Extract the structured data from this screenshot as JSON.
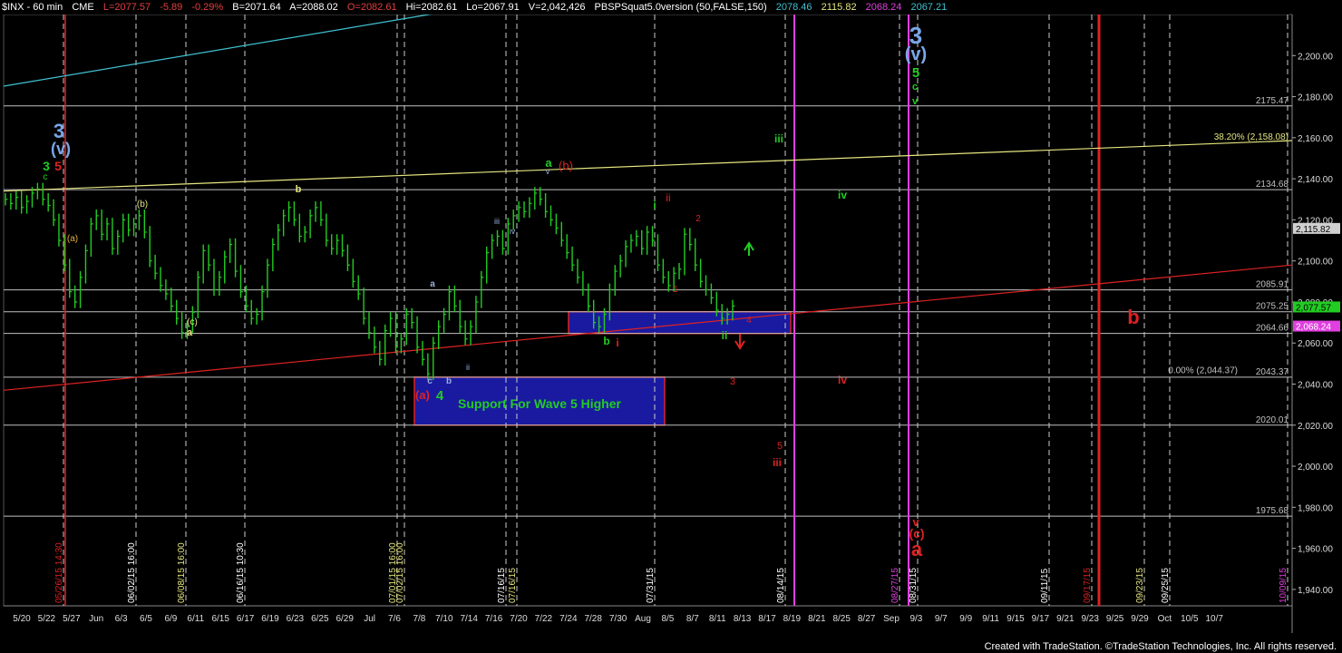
{
  "header": {
    "symbol": "$INX - 60 min",
    "exchange": "CME",
    "last": "L=2077.57",
    "change": "-5.89",
    "change_pct": "-0.29%",
    "bid": "B=2071.64",
    "ask": "A=2088.02",
    "open": "O=2082.61",
    "high": "Hi=2082.61",
    "low": "Lo=2067.91",
    "volume": "V=2,042,426",
    "indicator": "PBSPSquat5.0version (50,FALSE,150)",
    "ind_v1": "2078.46",
    "ind_v2": "2115.82",
    "ind_v3": "2068.24",
    "ind_v4": "2067.21"
  },
  "footer": "Created with TradeStation. ©TradeStation Technologies, Inc. All rights reserved.",
  "colors": {
    "background": "#000000",
    "price_bars": "#22cc22",
    "support_box": "#1a1aa0",
    "red_line": "#dd2222",
    "yellow_line": "#e6e680",
    "cyan_line": "#40c0d0",
    "magenta_line": "#e040e0",
    "grid_dash": "#ffffff"
  },
  "chart_data": {
    "type": "line",
    "title": "",
    "xlabel": "",
    "ylabel": "",
    "ylim": [
      1932,
      2220
    ],
    "y_ticks": [
      1940,
      1960,
      1980,
      2000,
      2020,
      2040,
      2060,
      2080,
      2100,
      2120,
      2140,
      2160,
      2180,
      2200
    ],
    "y_tick_labels": [
      "1,940.00",
      "1,960.00",
      "1,980.00",
      "2,000.00",
      "2,020.00",
      "2,040.00",
      "2,060.00",
      "2,080.00",
      "2,100.00",
      "2,120.00",
      "2,140.00",
      "2,160.00",
      "2,180.00",
      "2,200.00"
    ],
    "x_ticks": [
      "5/20",
      "5/22",
      "5/27",
      "Jun",
      "6/3",
      "6/5",
      "6/9",
      "6/11",
      "6/15",
      "6/17",
      "6/19",
      "6/23",
      "6/25",
      "6/29",
      "Jul",
      "7/6",
      "7/8",
      "7/10",
      "7/14",
      "7/16",
      "7/20",
      "7/22",
      "7/24",
      "7/28",
      "7/30",
      "Aug",
      "8/5",
      "8/7",
      "8/11",
      "8/13",
      "8/17",
      "8/19",
      "8/21",
      "8/25",
      "8/27",
      "Sep",
      "9/3",
      "9/7",
      "9/9",
      "9/11",
      "9/15",
      "9/17",
      "9/21",
      "9/23",
      "9/25",
      "9/29",
      "Oct",
      "10/5",
      "10/7"
    ],
    "series": [
      {
        "values": [
          2130,
          2128,
          2131,
          2126,
          2129,
          2133,
          2135,
          2130,
          2127,
          2120,
          2110,
          2098,
          2085,
          2080,
          2092,
          2105,
          2118,
          2122,
          2113,
          2118,
          2106,
          2112,
          2120,
          2115,
          2118,
          2122,
          2114,
          2100,
          2094,
          2088,
          2084,
          2078,
          2072,
          2065,
          2068,
          2075,
          2092,
          2105,
          2098,
          2086,
          2092,
          2102,
          2108,
          2095,
          2085,
          2078,
          2072,
          2074,
          2085,
          2098,
          2108,
          2115,
          2122,
          2126,
          2120,
          2112,
          2114,
          2122,
          2126,
          2120,
          2110,
          2106,
          2110,
          2105,
          2098,
          2090,
          2084,
          2072,
          2065,
          2058,
          2052,
          2066,
          2072,
          2058,
          2062,
          2074,
          2070,
          2058,
          2052,
          2045,
          2060,
          2068,
          2074,
          2085,
          2078,
          2068,
          2062,
          2068,
          2080,
          2092,
          2104,
          2110,
          2112,
          2106,
          2118,
          2122,
          2126,
          2124,
          2128,
          2133,
          2130,
          2124,
          2120,
          2116,
          2110,
          2104,
          2098,
          2092,
          2086,
          2078,
          2070,
          2068,
          2074,
          2086,
          2095,
          2100,
          2107,
          2110,
          2112,
          2106,
          2114,
          2110,
          2098,
          2092,
          2088,
          2094,
          2096,
          2113,
          2108,
          2098,
          2090,
          2086,
          2082,
          2076,
          2072,
          2074,
          2078
        ]
      }
    ],
    "horizontal_levels": [
      2175.47,
      2134.68,
      2085.91,
      2075.25,
      2064.66,
      2043.37,
      2020.01,
      1975.68
    ],
    "horizontal_level_labels": [
      "2175.47",
      "2134.68",
      "2085.91",
      "2075.25",
      "2064.66",
      "2043.37",
      "2020.01",
      "1975.68"
    ],
    "fib_labels": [
      "38.20% (2,158.08)",
      "0.00% (2,044.37)"
    ],
    "price_markers": [
      {
        "value": 2115.82,
        "label": "2,115.82",
        "color": "#000000",
        "bg": "#d0d0d0"
      },
      {
        "value": 2077.57,
        "label": "2,077.57",
        "color": "#000000",
        "bg": "#22cc22"
      },
      {
        "value": 2068.24,
        "label": "2,068.24",
        "color": "#ffffff",
        "bg": "#e040e0"
      }
    ],
    "support_box_label": "Support For Wave 5 Higher",
    "vertical_date_labels": [
      {
        "label": "05/26/15 14:30",
        "color": "#dd2222"
      },
      {
        "label": "06/02/15 16:00",
        "color": "#ffffff"
      },
      {
        "label": "06/08/15 16:00",
        "color": "#e6e680"
      },
      {
        "label": "06/16/15 10:30",
        "color": "#ffffff"
      },
      {
        "label": "07/01/15 16:00",
        "color": "#e6e680"
      },
      {
        "label": "07/02/15 16:00",
        "color": "#e6e680"
      },
      {
        "label": "07/16/15",
        "color": "#ffffff"
      },
      {
        "label": "07/16/15",
        "color": "#e6e680"
      },
      {
        "label": "07/31/15",
        "color": "#ffffff"
      },
      {
        "label": "08/14/15",
        "color": "#ffffff"
      },
      {
        "label": "08/27/15",
        "color": "#e040e0"
      },
      {
        "label": "08/31/15",
        "color": "#ffffff"
      },
      {
        "label": "09/11/15",
        "color": "#ffffff"
      },
      {
        "label": "09/17/15",
        "color": "#dd2222"
      },
      {
        "label": "09/23/15",
        "color": "#e6e680"
      },
      {
        "label": "09/25/15",
        "color": "#ffffff"
      },
      {
        "label": "10/09/15",
        "color": "#e040e0"
      }
    ],
    "annotations": [
      {
        "text": "3",
        "color": "#7aa6e8"
      },
      {
        "text": "(v)",
        "color": "#7aa6e8"
      },
      {
        "text": "3",
        "color": "#22cc22"
      },
      {
        "text": "5",
        "color": "#dd2222"
      },
      {
        "text": "c",
        "color": "#22cc22"
      },
      {
        "text": "(a)",
        "color": "#e6b040"
      },
      {
        "text": "(b)",
        "color": "#e6e680"
      },
      {
        "text": "(c)",
        "color": "#e6e680"
      },
      {
        "text": "a",
        "color": "#e6e680"
      },
      {
        "text": "b",
        "color": "#e6e680"
      },
      {
        "text": "a",
        "color": "#9ab0e0"
      },
      {
        "text": "b",
        "color": "#9ab0e0"
      },
      {
        "text": "c",
        "color": "#9ab0e0"
      },
      {
        "text": "ii",
        "color": "#9ab0e0"
      },
      {
        "text": "iii",
        "color": "#9ab0e0"
      },
      {
        "text": "iv",
        "color": "#9ab0e0"
      },
      {
        "text": "v",
        "color": "#9ab0e0"
      },
      {
        "text": "(a)",
        "color": "#dd2222"
      },
      {
        "text": "4",
        "color": "#22cc22"
      },
      {
        "text": "a",
        "color": "#22cc22"
      },
      {
        "text": "(b)",
        "color": "#dd2222"
      },
      {
        "text": "b",
        "color": "#22cc22"
      },
      {
        "text": "i",
        "color": "#dd2222"
      },
      {
        "text": "i",
        "color": "#22cc22"
      },
      {
        "text": "ii",
        "color": "#dd2222"
      },
      {
        "text": "1",
        "color": "#dd2222"
      },
      {
        "text": "2",
        "color": "#dd2222"
      },
      {
        "text": "ii",
        "color": "#22cc22"
      },
      {
        "text": "4",
        "color": "#dd2222"
      },
      {
        "text": "3",
        "color": "#dd2222"
      },
      {
        "text": "5",
        "color": "#dd2222"
      },
      {
        "text": "iii",
        "color": "#dd2222"
      },
      {
        "text": "iii",
        "color": "#22cc22"
      },
      {
        "text": "iv",
        "color": "#22cc22"
      },
      {
        "text": "iv",
        "color": "#dd2222"
      },
      {
        "text": "3",
        "color": "#7aa6e8"
      },
      {
        "text": "(v)",
        "color": "#7aa6e8"
      },
      {
        "text": "5",
        "color": "#22cc22"
      },
      {
        "text": "c",
        "color": "#22cc22"
      },
      {
        "text": "v",
        "color": "#22cc22"
      },
      {
        "text": "v",
        "color": "#dd2222"
      },
      {
        "text": "(c)",
        "color": "#dd2222"
      },
      {
        "text": "a",
        "color": "#dd2222"
      },
      {
        "text": "b",
        "color": "#dd2222"
      }
    ]
  }
}
